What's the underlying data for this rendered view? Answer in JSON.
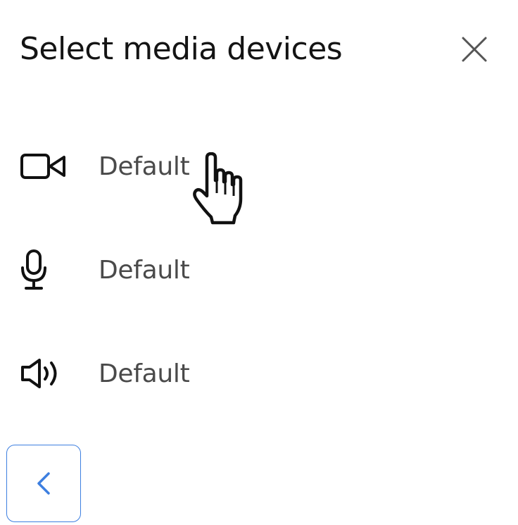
{
  "dialog": {
    "title": "Select media devices"
  },
  "devices": [
    {
      "kind": "camera",
      "icon": "video-camera-icon",
      "selected": "Default"
    },
    {
      "kind": "microphone",
      "icon": "microphone-icon",
      "selected": "Default"
    },
    {
      "kind": "speaker",
      "icon": "speaker-icon",
      "selected": "Default"
    }
  ],
  "icons": {
    "close": "close-icon",
    "back": "chevron-left-icon",
    "cursor": "hand-pointer-cursor"
  },
  "colors": {
    "accent": "#3d7fe0",
    "text": "#141414",
    "muted_text": "#4a4a4a"
  }
}
